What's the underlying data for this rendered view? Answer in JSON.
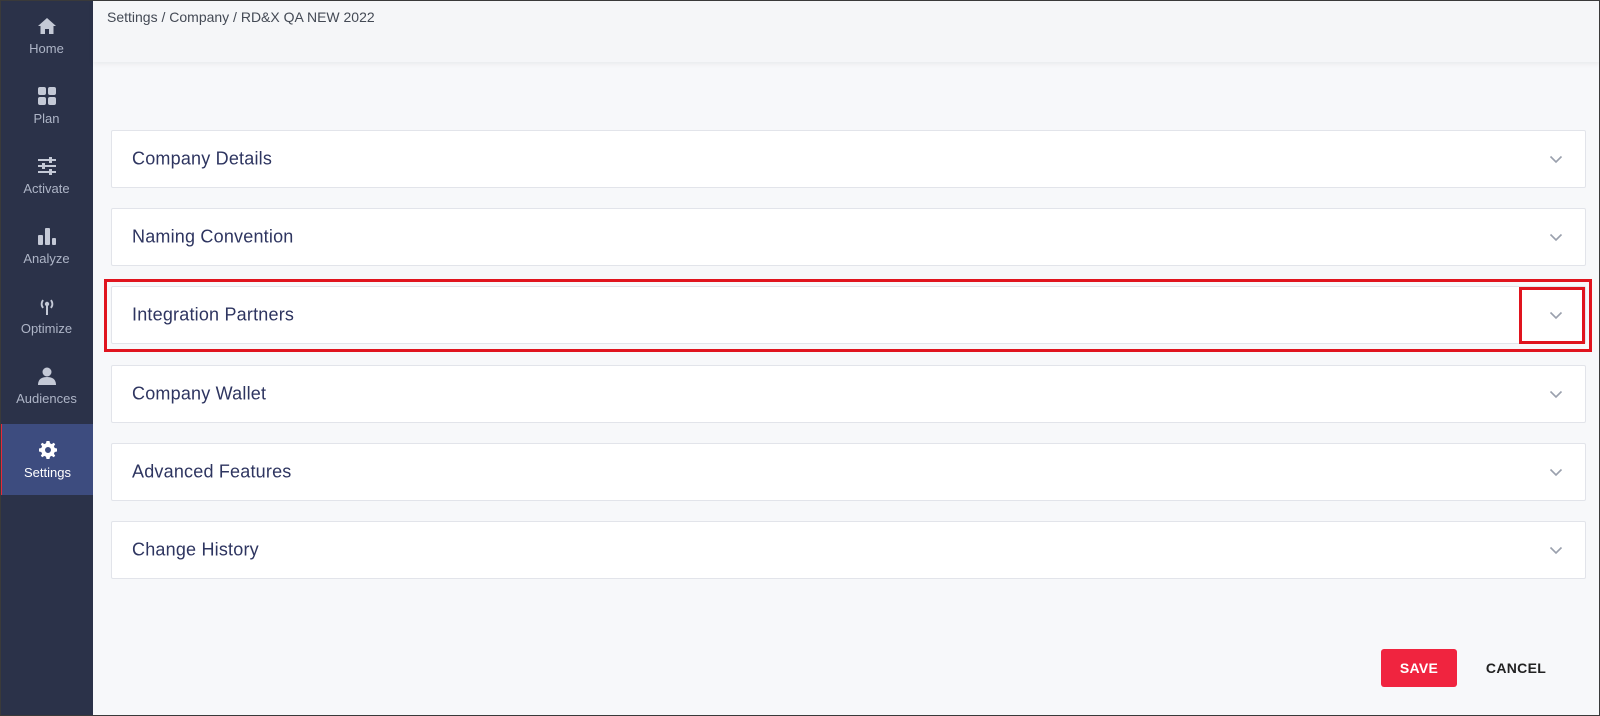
{
  "sidebar": {
    "items": [
      {
        "label": "Home",
        "icon": "home-icon"
      },
      {
        "label": "Plan",
        "icon": "grid-icon"
      },
      {
        "label": "Activate",
        "icon": "sliders-icon"
      },
      {
        "label": "Analyze",
        "icon": "bar-chart-icon"
      },
      {
        "label": "Optimize",
        "icon": "broadcast-icon"
      },
      {
        "label": "Audiences",
        "icon": "person-icon"
      },
      {
        "label": "Settings",
        "icon": "gear-icon",
        "active": true
      }
    ]
  },
  "header": {
    "breadcrumb": "Settings / Company / RD&X QA NEW 2022"
  },
  "sections": [
    {
      "title": "Company Details"
    },
    {
      "title": "Naming Convention"
    },
    {
      "title": "Integration Partners"
    },
    {
      "title": "Company Wallet"
    },
    {
      "title": "Advanced Features"
    },
    {
      "title": "Change History"
    }
  ],
  "actions": {
    "save": "SAVE",
    "cancel": "CANCEL"
  },
  "colors": {
    "sidebar_bg": "#2b3249",
    "sidebar_active": "#3d4c7f",
    "accent_red": "#f0243f",
    "highlight": "#e0141e",
    "panel_title": "#2e3560"
  }
}
